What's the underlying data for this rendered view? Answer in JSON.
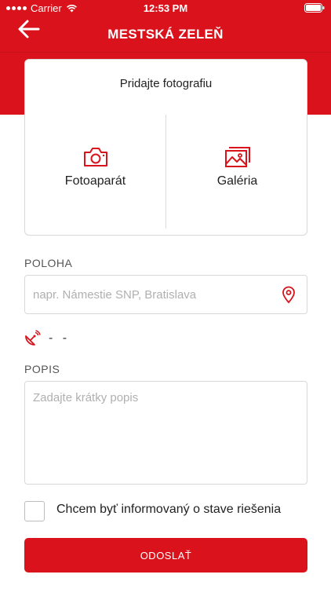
{
  "status_bar": {
    "carrier": "Carrier",
    "time": "12:53 PM"
  },
  "nav": {
    "title": "MESTSKÁ ZELEŇ",
    "back_icon": "arrow-left-icon"
  },
  "photo": {
    "title": "Pridajte fotografiu",
    "camera_label": "Fotoaparát",
    "gallery_label": "Galéria"
  },
  "location": {
    "label": "POLOHA",
    "placeholder": "napr. Námestie SNP, Bratislava",
    "value": "",
    "gps_coords": "- -"
  },
  "description": {
    "label": "POPIS",
    "placeholder": "Zadajte krátky popis",
    "value": ""
  },
  "notify": {
    "label": "Chcem byť informovaný o stave riešenia",
    "checked": false
  },
  "submit": {
    "label": "ODOSLAŤ"
  },
  "colors": {
    "accent": "#d9121b"
  }
}
